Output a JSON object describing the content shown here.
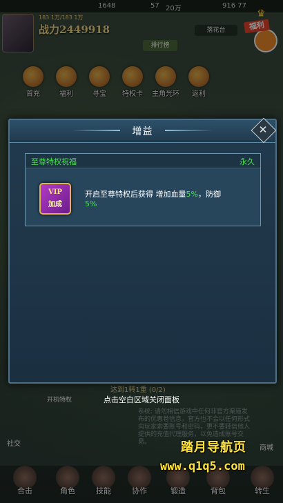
{
  "hud": {
    "top_currency_1": "1648",
    "top_currency_2": "57",
    "top_currency_2_unit": "20万",
    "top_currency_3": "916 77",
    "level_text": "183 1万/183 1万",
    "power_label": "战力",
    "power_value": "2449918",
    "server_text": "落花台",
    "ranking_label": "排行榜",
    "welfare_label": "福利"
  },
  "icons_row1": [
    {
      "label": "首充"
    },
    {
      "label": "福利"
    },
    {
      "label": "寻宝"
    },
    {
      "label": "特权卡"
    },
    {
      "label": "主角光环"
    },
    {
      "label": "返利"
    }
  ],
  "modal": {
    "title": "增益",
    "close_icon": "close-icon",
    "buff": {
      "name": "至尊特权祝福",
      "duration": "永久",
      "icon_text_top": "VIP",
      "icon_text_bottom": "加成",
      "desc_prefix": "开启至尊特权后获得  增加血量",
      "hp_value": "5%",
      "desc_mid": "，防御",
      "def_value": "5%",
      "highlight_color": "#49e24f"
    }
  },
  "hint": "点击空白区域关闭面板",
  "quest": "达到1转1重 (0/2)",
  "bottom_nav": [
    {
      "label": "合击"
    },
    {
      "label": "角色"
    },
    {
      "label": "技能"
    },
    {
      "label": "协作"
    },
    {
      "label": "锻造"
    },
    {
      "label": "背包"
    },
    {
      "label": "转生"
    }
  ],
  "side": {
    "social_label": "社交",
    "shop_label": "商城",
    "vip_label": "开机特权"
  },
  "chat_text": "系统: 请勿相信游戏中任何非官方渠道发布的优惠卷信息，官方也不会以任何形式向玩家索要账号和密码，更不要轻信他人提供的充值代理服务，以免造成账号交易。",
  "watermark": {
    "line1": "踏月导航页",
    "line2": "www.q1q5.com"
  }
}
